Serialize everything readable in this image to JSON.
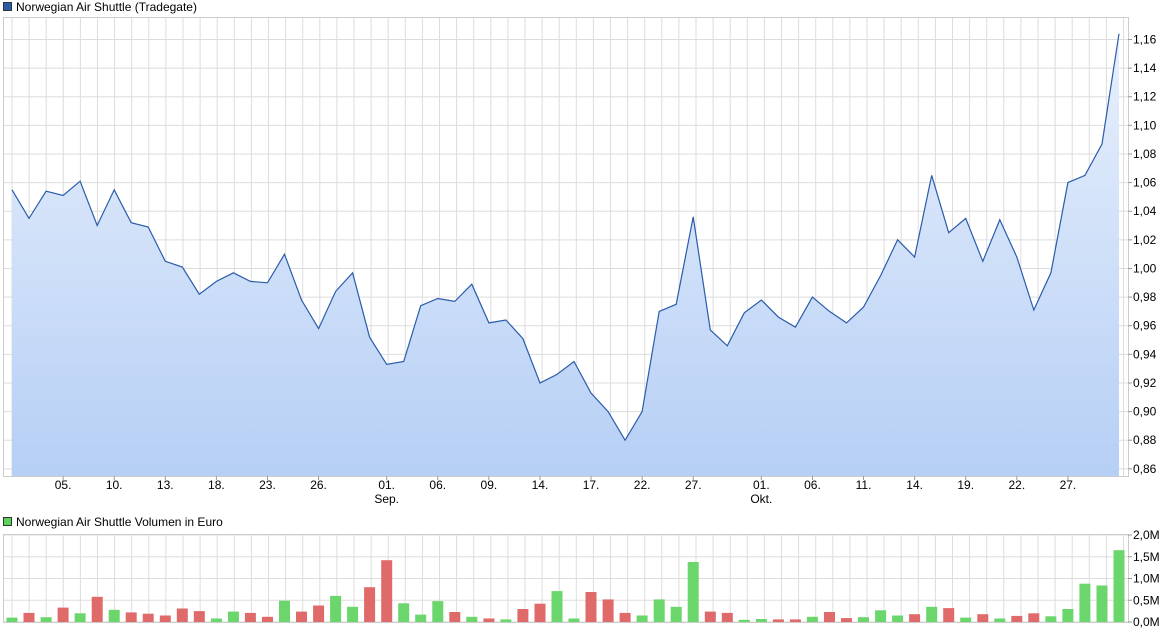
{
  "colors": {
    "price_line": "#2a5caa",
    "price_legend": "#2a5caa",
    "volume_legend": "#5bd35b",
    "volume_up": "#6bd66b",
    "volume_down": "#e06a6a",
    "grid": "#dddddd",
    "area_top": "#e8f0fc",
    "area_bottom": "#b6cff5"
  },
  "chart_data": [
    {
      "type": "area",
      "title": "Norwegian Air Shuttle (Tradegate)",
      "xlabel": "",
      "ylabel": "",
      "ylim": [
        0.855,
        1.175
      ],
      "grid": true,
      "y_ticks": [
        "0,86",
        "0,88",
        "0,90",
        "0,92",
        "0,94",
        "0,96",
        "0,98",
        "1,00",
        "1,02",
        "1,04",
        "1,06",
        "1,08",
        "1,10",
        "1,12",
        "1,14",
        "1,16"
      ],
      "y_tick_values": [
        0.86,
        0.88,
        0.9,
        0.92,
        0.94,
        0.96,
        0.98,
        1.0,
        1.02,
        1.04,
        1.06,
        1.08,
        1.1,
        1.12,
        1.14,
        1.16
      ],
      "x_ticks": [
        {
          "label": "05.",
          "sub": "",
          "index": 3
        },
        {
          "label": "10.",
          "sub": "",
          "index": 6
        },
        {
          "label": "13.",
          "sub": "",
          "index": 9
        },
        {
          "label": "18.",
          "sub": "",
          "index": 12
        },
        {
          "label": "23.",
          "sub": "",
          "index": 15
        },
        {
          "label": "26.",
          "sub": "",
          "index": 18
        },
        {
          "label": "01.",
          "sub": "Sep.",
          "index": 22
        },
        {
          "label": "06.",
          "sub": "",
          "index": 25
        },
        {
          "label": "09.",
          "sub": "",
          "index": 28
        },
        {
          "label": "14.",
          "sub": "",
          "index": 31
        },
        {
          "label": "17.",
          "sub": "",
          "index": 34
        },
        {
          "label": "22.",
          "sub": "",
          "index": 37
        },
        {
          "label": "27.",
          "sub": "",
          "index": 40
        },
        {
          "label": "01.",
          "sub": "Okt.",
          "index": 44
        },
        {
          "label": "06.",
          "sub": "",
          "index": 47
        },
        {
          "label": "11.",
          "sub": "",
          "index": 50
        },
        {
          "label": "14.",
          "sub": "",
          "index": 53
        },
        {
          "label": "19.",
          "sub": "",
          "index": 56
        },
        {
          "label": "22.",
          "sub": "",
          "index": 59
        },
        {
          "label": "27.",
          "sub": "",
          "index": 62
        }
      ],
      "series": [
        {
          "values": [
            1.055,
            1.035,
            1.054,
            1.051,
            1.061,
            1.03,
            1.055,
            1.032,
            1.029,
            1.005,
            1.001,
            0.982,
            0.991,
            0.997,
            0.991,
            0.99,
            1.01,
            0.978,
            0.958,
            0.984,
            0.997,
            0.952,
            0.933,
            0.935,
            0.974,
            0.979,
            0.977,
            0.989,
            0.962,
            0.964,
            0.951,
            0.92,
            0.926,
            0.935,
            0.913,
            0.9,
            0.88,
            0.9,
            0.97,
            0.975,
            1.036,
            0.957,
            0.946,
            0.969,
            0.978,
            0.966,
            0.959,
            0.98,
            0.97,
            0.962,
            0.973,
            0.995,
            1.02,
            1.008,
            1.065,
            1.025,
            1.035,
            1.005,
            1.034,
            1.008,
            0.971,
            0.997,
            1.06,
            1.065,
            1.087,
            1.164
          ]
        }
      ]
    },
    {
      "type": "bar",
      "title": "Norwegian Air Shuttle Volumen in Euro",
      "xlabel": "",
      "ylabel": "",
      "ylim": [
        0,
        2.0
      ],
      "grid": true,
      "y_ticks": [
        "0,0M",
        "0,5M",
        "1,0M",
        "1,5M",
        "2,0M"
      ],
      "y_tick_values": [
        0,
        0.5,
        1.0,
        1.5,
        2.0
      ],
      "series": [
        {
          "values": [
            0.1,
            0.21,
            0.11,
            0.33,
            0.2,
            0.58,
            0.28,
            0.22,
            0.19,
            0.15,
            0.31,
            0.25,
            0.08,
            0.24,
            0.21,
            0.12,
            0.49,
            0.24,
            0.38,
            0.6,
            0.35,
            0.8,
            1.42,
            0.43,
            0.17,
            0.48,
            0.23,
            0.12,
            0.08,
            0.06,
            0.3,
            0.42,
            0.71,
            0.08,
            0.69,
            0.52,
            0.21,
            0.15,
            0.52,
            0.35,
            1.38,
            0.24,
            0.21,
            0.05,
            0.07,
            0.06,
            0.06,
            0.12,
            0.23,
            0.09,
            0.11,
            0.27,
            0.15,
            0.18,
            0.35,
            0.32,
            0.1,
            0.18,
            0.08,
            0.14,
            0.2,
            0.13,
            0.3,
            0.88,
            0.84,
            1.65
          ]
        }
      ]
    }
  ]
}
